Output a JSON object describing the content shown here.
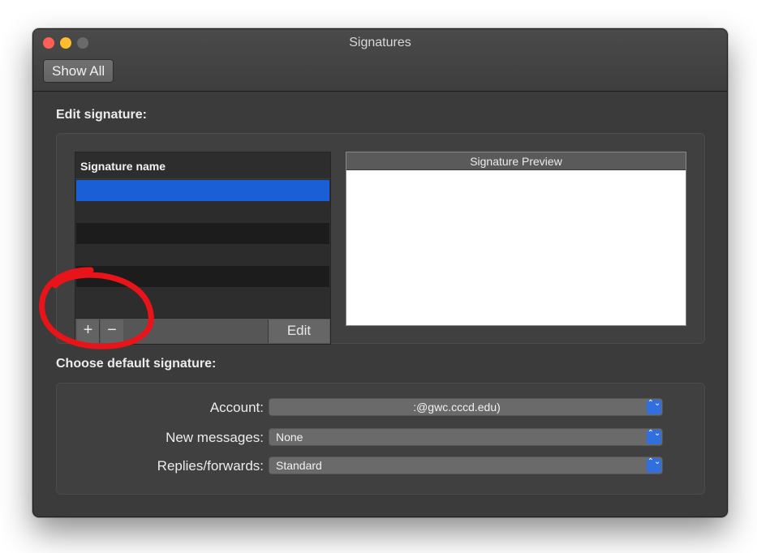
{
  "window": {
    "title": "Signatures",
    "show_all_label": "Show All"
  },
  "edit_section": {
    "label": "Edit signature:",
    "list_header": "Signature name",
    "rows": [
      {
        "selected": true,
        "color": "#1a5fd6"
      },
      {
        "selected": false,
        "color": "#2c2c2c"
      },
      {
        "selected": false,
        "color": "#1c1c1c"
      },
      {
        "selected": false,
        "color": "#2c2c2c"
      },
      {
        "selected": false,
        "color": "#1c1c1c"
      }
    ],
    "plus_label": "+",
    "minus_label": "−",
    "edit_label": "Edit",
    "preview_header": "Signature Preview"
  },
  "default_section": {
    "label": "Choose default signature:",
    "account_label": "Account:",
    "account_value": ":@gwc.cccd.edu)",
    "new_messages_label": "New messages:",
    "new_messages_value": "None",
    "replies_label": "Replies/forwards:",
    "replies_value": "Standard",
    "popup_arrows": "⌃⌄"
  },
  "colors": {
    "accent": "#2f6fe0",
    "selection": "#1a5fd6",
    "annotation": "#e8141a"
  }
}
